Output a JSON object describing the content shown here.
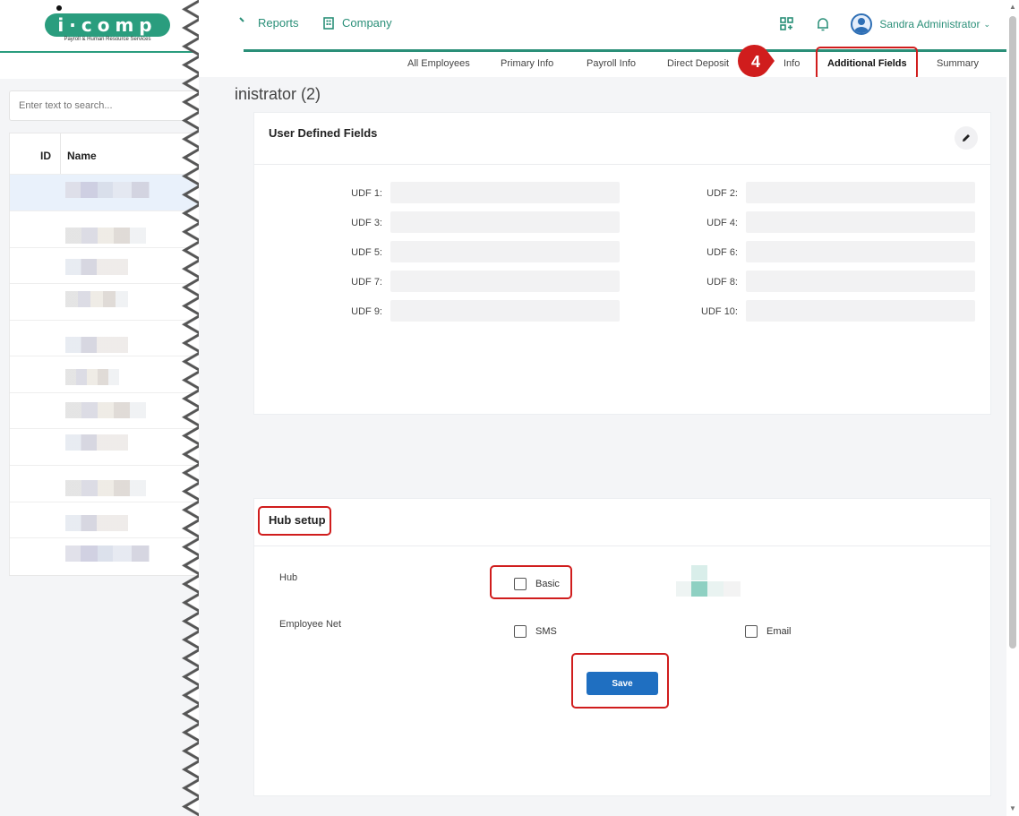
{
  "brand": {
    "logo_text": "i·comp",
    "tagline": "Payroll & Human Resource Services",
    "accent": "#2a8f78",
    "logo_green": "#2a9d7e",
    "callout_red": "#d01d1d"
  },
  "topnav": {
    "reports_label": "Reports",
    "company_label": "Company",
    "user_name": "Sandra Administrator",
    "icons": [
      "apps-icon",
      "bell-icon",
      "user-avatar-icon",
      "chevron-down-icon"
    ]
  },
  "search": {
    "placeholder": "Enter text to search..."
  },
  "employee_table": {
    "columns": [
      "ID",
      "Name"
    ],
    "rows": 11
  },
  "tabs": [
    {
      "label": "All Employees"
    },
    {
      "label": "Primary Info"
    },
    {
      "label": "Payroll Info"
    },
    {
      "label": "Direct Deposit"
    },
    {
      "label": "Info"
    },
    {
      "label": "Additional Fields",
      "active": true
    },
    {
      "label": "Summary"
    }
  ],
  "step_badge": "4",
  "page_title": "inistrator (2)",
  "udf_card": {
    "title": "User Defined Fields",
    "fields": [
      {
        "label": "UDF 1:",
        "value": ""
      },
      {
        "label": "UDF 2:",
        "value": ""
      },
      {
        "label": "UDF 3:",
        "value": ""
      },
      {
        "label": "UDF 4:",
        "value": ""
      },
      {
        "label": "UDF 5:",
        "value": ""
      },
      {
        "label": "UDF 6:",
        "value": ""
      },
      {
        "label": "UDF 7:",
        "value": ""
      },
      {
        "label": "UDF 8:",
        "value": ""
      },
      {
        "label": "UDF 9:",
        "value": ""
      },
      {
        "label": "UDF 10:",
        "value": ""
      }
    ]
  },
  "hub_card": {
    "title": "Hub setup",
    "hub_label": "Hub",
    "basic_label": "Basic",
    "employee_net_label": "Employee Net",
    "sms_label": "SMS",
    "email_label": "Email",
    "save_label": "Save"
  }
}
